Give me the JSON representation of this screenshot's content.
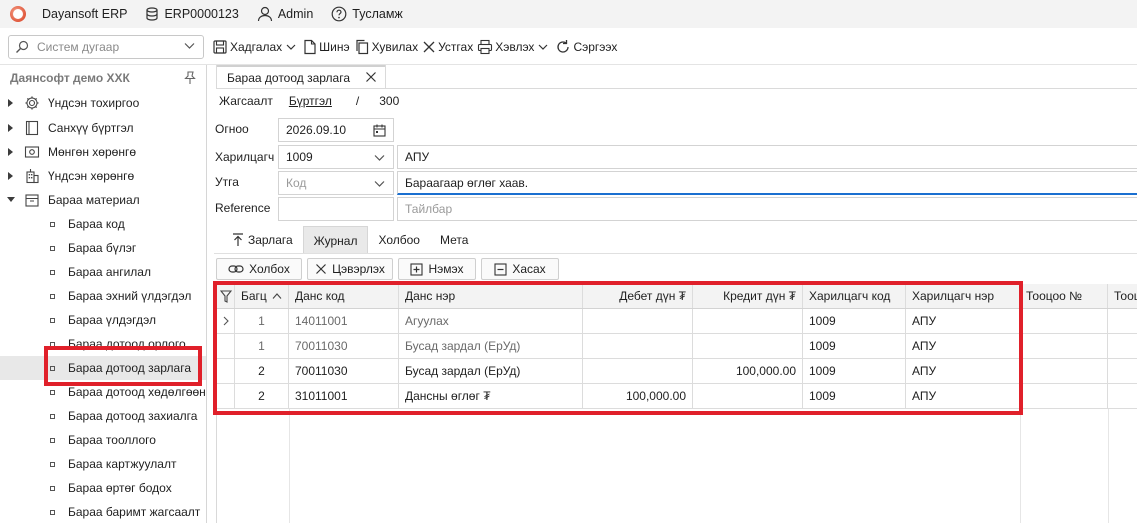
{
  "titlebar": {
    "app_name": "Dayansoft ERP",
    "db_name": "ERP0000123",
    "user": "Admin",
    "help": "Тусламж"
  },
  "toolbar": {
    "search_placeholder": "Систем дугаар",
    "save": "Хадгалах",
    "new": "Шинэ",
    "copy": "Хувилах",
    "delete": "Устгах",
    "print": "Хэвлэх",
    "refresh": "Сэргээх"
  },
  "sidebar": {
    "company": "Даянсофт демо ХХК",
    "groups": [
      {
        "label": "Үндсэн тохиргоо",
        "icon": "gear-icon"
      },
      {
        "label": "Санхүү бүртгэл",
        "icon": "book-icon"
      },
      {
        "label": "Мөнгөн хөрөнгө",
        "icon": "money-icon"
      },
      {
        "label": "Үндсэн хөрөнгө",
        "icon": "building-icon"
      },
      {
        "label": "Бараа материал",
        "icon": "box-icon"
      }
    ],
    "sub_items": [
      "Бараа код",
      "Бараа бүлэг",
      "Бараа ангилал",
      "Бараа эхний үлдэгдэл",
      "Бараа үлдэгдэл",
      "Бараа дотоод орлого",
      "Бараа дотоод зарлага",
      "Бараа дотоод хөдөлгөөн",
      "Бараа дотоод захиалга",
      "Бараа тооллого",
      "Бараа картжуулалт",
      "Бараа өртөг бодох",
      "Бараа баримт жагсаалт"
    ]
  },
  "document": {
    "tab_title": "Бараа дотоод зарлага",
    "status_label": "Жагсаалт",
    "status_value": "Бүртгэл",
    "separator": "/",
    "count": "300",
    "date_label": "Огноо",
    "date_value": "2026.09.10",
    "partner_label": "Харилцагч",
    "partner_code": "1009",
    "partner_name": "АПУ",
    "purpose_label": "Утга",
    "purpose_code_placeholder": "Код",
    "purpose_text": "Бараагаар өглөг хаав.",
    "reference_label": "Reference",
    "reference_value": "",
    "note_placeholder": "Тайлбар"
  },
  "subtabs": [
    "Зарлага",
    "Журнал",
    "Холбоо",
    "Мета"
  ],
  "grid_buttons": {
    "link": "Холбох",
    "clear": "Цэвэрлэх",
    "add": "Нэмэх",
    "remove": "Хасах"
  },
  "journal": {
    "columns": [
      "Багц",
      "Данс код",
      "Данс нэр",
      "Дебет дүн ₮",
      "Кредит дүн ₮",
      "Харилцагч код",
      "Харилцагч нэр",
      "Тооцоо №",
      "Тооц"
    ],
    "rows": [
      {
        "batch": "1",
        "account_code": "14011001",
        "account_name": "Агуулах",
        "debit": "",
        "credit": "",
        "partner_code": "1009",
        "partner_name": "АПУ"
      },
      {
        "batch": "1",
        "account_code": "70011030",
        "account_name": "Бусад зардал (ЕрУд)",
        "debit": "",
        "credit": "",
        "partner_code": "1009",
        "partner_name": "АПУ"
      },
      {
        "batch": "2",
        "account_code": "70011030",
        "account_name": "Бусад зардал (ЕрУд)",
        "debit": "",
        "credit": "100,000.00",
        "partner_code": "1009",
        "partner_name": "АПУ"
      },
      {
        "batch": "2",
        "account_code": "31011001",
        "account_name": "Дансны өглөг ₮",
        "debit": "100,000.00",
        "credit": "",
        "partner_code": "1009",
        "partner_name": "АПУ"
      }
    ]
  },
  "colors": {
    "highlight": "#e0202a",
    "accent": "#1a6fd0"
  }
}
